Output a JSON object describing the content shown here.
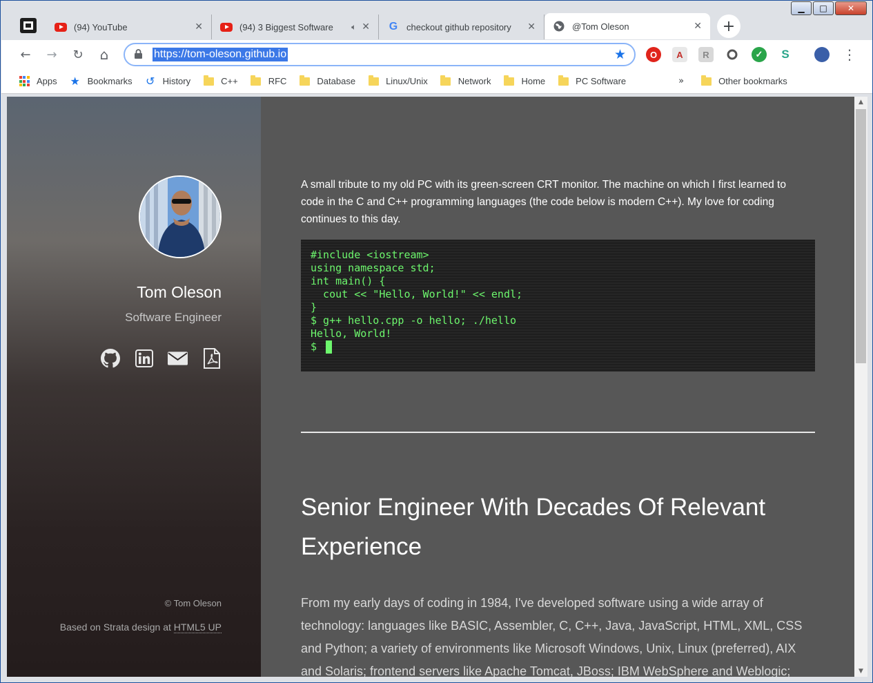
{
  "window": {
    "minimize": "▁",
    "maximize": "□",
    "close": "✕"
  },
  "tabs": [
    {
      "title": "(94) YouTube",
      "favicon": "youtube-icon",
      "muted": false
    },
    {
      "title": "(94) 3 Biggest Software",
      "favicon": "youtube-icon",
      "audio": true
    },
    {
      "title": "checkout github repository",
      "favicon": "google-icon"
    },
    {
      "title": "@Tom Oleson",
      "favicon": "globe-icon",
      "active": true
    }
  ],
  "toolbar": {
    "url": "https://tom-oleson.github.io",
    "back": "←",
    "forward": "→",
    "reload": "↻",
    "home": "⌂",
    "star": "★",
    "menu": "⋮"
  },
  "bookmarks": {
    "items": [
      {
        "label": "Apps",
        "icon": "apps-grid-icon"
      },
      {
        "label": "Bookmarks",
        "icon": "star-icon"
      },
      {
        "label": "History",
        "icon": "history-icon"
      },
      {
        "label": "C++",
        "icon": "folder-icon"
      },
      {
        "label": "RFC",
        "icon": "folder-icon"
      },
      {
        "label": "Database",
        "icon": "folder-icon"
      },
      {
        "label": "Linux/Unix",
        "icon": "folder-icon"
      },
      {
        "label": "Network",
        "icon": "folder-icon"
      },
      {
        "label": "Home",
        "icon": "folder-icon"
      },
      {
        "label": "PC Software",
        "icon": "folder-icon"
      }
    ],
    "overflow": "»",
    "other": "Other bookmarks"
  },
  "sidebar": {
    "name": "Tom Oleson",
    "role": "Software Engineer",
    "socials": [
      "github-icon",
      "linkedin-icon",
      "email-icon",
      "pdf-resume-icon"
    ],
    "copyright": "© Tom Oleson",
    "credit_prefix": "Based on Strata design at ",
    "credit_link": "HTML5 UP"
  },
  "main": {
    "intro": "A small tribute to my old PC with its green-screen CRT monitor. The machine on which I first learned to code in the C and C++ programming languages (the code below is modern C++). My love for coding continues to this day.",
    "code_lines": [
      "#include <iostream>",
      "using namespace std;",
      "int main() {",
      "  cout << \"Hello, World!\" << endl;",
      "}",
      "$ g++ hello.cpp -o hello; ./hello",
      "Hello, World!",
      "$ "
    ],
    "heading": "Senior Engineer With Decades Of Relevant Experience",
    "body": "From my early days of coding in 1984, I've developed software using a wide array of technology: languages like BASIC, Assembler, C, C++, Java, JavaScript, HTML, XML, CSS and Python; a variety of environments like Microsoft Windows, Unix, Linux (preferred), AIX and Solaris; frontend servers like Apache Tomcat, JBoss; IBM WebSphere and Weblogic; backend"
  },
  "colors": {
    "terminal_green": "#6df76d",
    "accent_blue": "#1a73e8",
    "content_bg": "#575757"
  }
}
